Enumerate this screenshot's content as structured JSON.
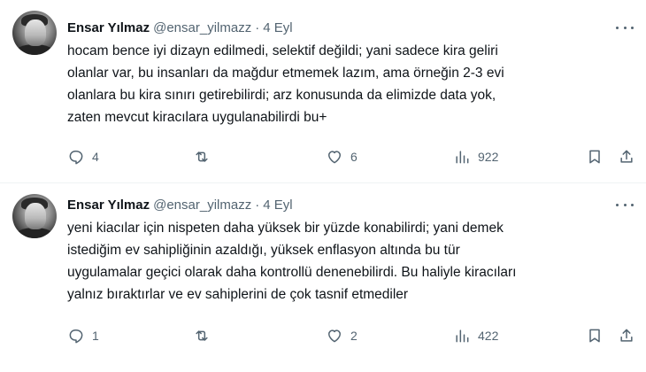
{
  "tweets": [
    {
      "author": {
        "name": "Ensar Yılmaz",
        "handle": "@ensar_yilmazz",
        "separator": "·",
        "date": "4 Eyl"
      },
      "lines": [
        "hocam bence iyi dizayn edilmedi, selektif değildi; yani sadece kira geliri",
        "olanlar var, bu insanları da mağdur etmemek lazım, ama örneğin 2-3 evi",
        "olanlara bu kira sınırı getirebilirdi; arz konusunda da elimizde data yok,",
        "zaten mevcut kiracılara uygulanabilirdi bu+"
      ],
      "stats": {
        "replies": "4",
        "retweets": "",
        "likes": "6",
        "views": "922"
      }
    },
    {
      "author": {
        "name": "Ensar Yılmaz",
        "handle": "@ensar_yilmazz",
        "separator": "·",
        "date": "4 Eyl"
      },
      "lines": [
        "yeni kiacılar için nispeten daha yüksek bir yüzde konabilirdi; yani demek",
        "istediğim ev sahipliğinin azaldığı, yüksek enflasyon altında bu tür",
        "uygulamalar geçici olarak daha kontrollü denenebilirdi. Bu haliyle kiracıları",
        "yalnız bıraktırlar ve ev sahiplerini de çok tasnif etmediler"
      ],
      "stats": {
        "replies": "1",
        "retweets": "",
        "likes": "2",
        "views": "422"
      }
    }
  ],
  "icons": {
    "reply": "reply-icon",
    "retweet": "retweet-icon",
    "like": "heart-icon",
    "views": "views-icon",
    "bookmark": "bookmark-icon",
    "share": "share-icon",
    "more": "more-options-icon"
  },
  "colors": {
    "text": "#0f1419",
    "secondary": "#536471",
    "divider": "#eff3f4"
  }
}
